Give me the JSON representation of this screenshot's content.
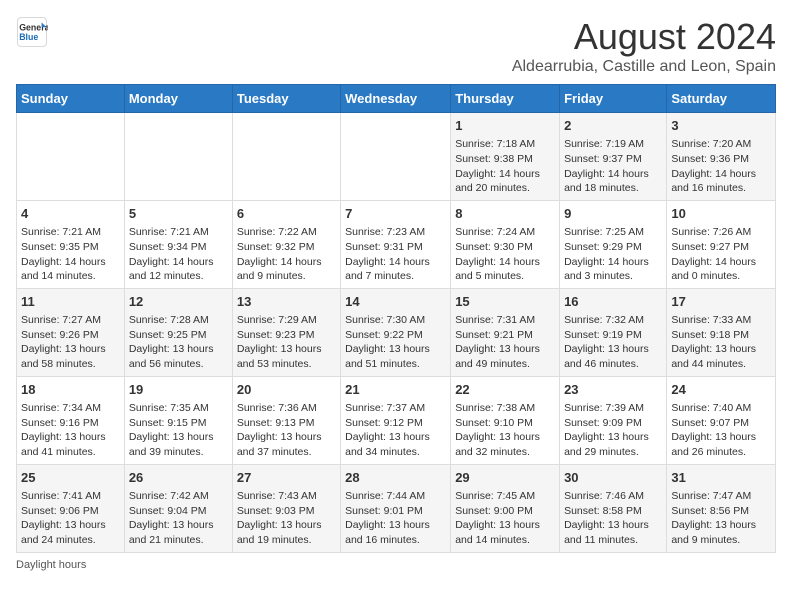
{
  "header": {
    "logo_general": "General",
    "logo_blue": "Blue",
    "title": "August 2024",
    "subtitle": "Aldearrubia, Castille and Leon, Spain"
  },
  "days_of_week": [
    "Sunday",
    "Monday",
    "Tuesday",
    "Wednesday",
    "Thursday",
    "Friday",
    "Saturday"
  ],
  "weeks": [
    [
      {
        "day": "",
        "info": ""
      },
      {
        "day": "",
        "info": ""
      },
      {
        "day": "",
        "info": ""
      },
      {
        "day": "",
        "info": ""
      },
      {
        "day": "1",
        "info": "Sunrise: 7:18 AM\nSunset: 9:38 PM\nDaylight: 14 hours and 20 minutes."
      },
      {
        "day": "2",
        "info": "Sunrise: 7:19 AM\nSunset: 9:37 PM\nDaylight: 14 hours and 18 minutes."
      },
      {
        "day": "3",
        "info": "Sunrise: 7:20 AM\nSunset: 9:36 PM\nDaylight: 14 hours and 16 minutes."
      }
    ],
    [
      {
        "day": "4",
        "info": "Sunrise: 7:21 AM\nSunset: 9:35 PM\nDaylight: 14 hours and 14 minutes."
      },
      {
        "day": "5",
        "info": "Sunrise: 7:21 AM\nSunset: 9:34 PM\nDaylight: 14 hours and 12 minutes."
      },
      {
        "day": "6",
        "info": "Sunrise: 7:22 AM\nSunset: 9:32 PM\nDaylight: 14 hours and 9 minutes."
      },
      {
        "day": "7",
        "info": "Sunrise: 7:23 AM\nSunset: 9:31 PM\nDaylight: 14 hours and 7 minutes."
      },
      {
        "day": "8",
        "info": "Sunrise: 7:24 AM\nSunset: 9:30 PM\nDaylight: 14 hours and 5 minutes."
      },
      {
        "day": "9",
        "info": "Sunrise: 7:25 AM\nSunset: 9:29 PM\nDaylight: 14 hours and 3 minutes."
      },
      {
        "day": "10",
        "info": "Sunrise: 7:26 AM\nSunset: 9:27 PM\nDaylight: 14 hours and 0 minutes."
      }
    ],
    [
      {
        "day": "11",
        "info": "Sunrise: 7:27 AM\nSunset: 9:26 PM\nDaylight: 13 hours and 58 minutes."
      },
      {
        "day": "12",
        "info": "Sunrise: 7:28 AM\nSunset: 9:25 PM\nDaylight: 13 hours and 56 minutes."
      },
      {
        "day": "13",
        "info": "Sunrise: 7:29 AM\nSunset: 9:23 PM\nDaylight: 13 hours and 53 minutes."
      },
      {
        "day": "14",
        "info": "Sunrise: 7:30 AM\nSunset: 9:22 PM\nDaylight: 13 hours and 51 minutes."
      },
      {
        "day": "15",
        "info": "Sunrise: 7:31 AM\nSunset: 9:21 PM\nDaylight: 13 hours and 49 minutes."
      },
      {
        "day": "16",
        "info": "Sunrise: 7:32 AM\nSunset: 9:19 PM\nDaylight: 13 hours and 46 minutes."
      },
      {
        "day": "17",
        "info": "Sunrise: 7:33 AM\nSunset: 9:18 PM\nDaylight: 13 hours and 44 minutes."
      }
    ],
    [
      {
        "day": "18",
        "info": "Sunrise: 7:34 AM\nSunset: 9:16 PM\nDaylight: 13 hours and 41 minutes."
      },
      {
        "day": "19",
        "info": "Sunrise: 7:35 AM\nSunset: 9:15 PM\nDaylight: 13 hours and 39 minutes."
      },
      {
        "day": "20",
        "info": "Sunrise: 7:36 AM\nSunset: 9:13 PM\nDaylight: 13 hours and 37 minutes."
      },
      {
        "day": "21",
        "info": "Sunrise: 7:37 AM\nSunset: 9:12 PM\nDaylight: 13 hours and 34 minutes."
      },
      {
        "day": "22",
        "info": "Sunrise: 7:38 AM\nSunset: 9:10 PM\nDaylight: 13 hours and 32 minutes."
      },
      {
        "day": "23",
        "info": "Sunrise: 7:39 AM\nSunset: 9:09 PM\nDaylight: 13 hours and 29 minutes."
      },
      {
        "day": "24",
        "info": "Sunrise: 7:40 AM\nSunset: 9:07 PM\nDaylight: 13 hours and 26 minutes."
      }
    ],
    [
      {
        "day": "25",
        "info": "Sunrise: 7:41 AM\nSunset: 9:06 PM\nDaylight: 13 hours and 24 minutes."
      },
      {
        "day": "26",
        "info": "Sunrise: 7:42 AM\nSunset: 9:04 PM\nDaylight: 13 hours and 21 minutes."
      },
      {
        "day": "27",
        "info": "Sunrise: 7:43 AM\nSunset: 9:03 PM\nDaylight: 13 hours and 19 minutes."
      },
      {
        "day": "28",
        "info": "Sunrise: 7:44 AM\nSunset: 9:01 PM\nDaylight: 13 hours and 16 minutes."
      },
      {
        "day": "29",
        "info": "Sunrise: 7:45 AM\nSunset: 9:00 PM\nDaylight: 13 hours and 14 minutes."
      },
      {
        "day": "30",
        "info": "Sunrise: 7:46 AM\nSunset: 8:58 PM\nDaylight: 13 hours and 11 minutes."
      },
      {
        "day": "31",
        "info": "Sunrise: 7:47 AM\nSunset: 8:56 PM\nDaylight: 13 hours and 9 minutes."
      }
    ]
  ],
  "footer": {
    "daylight_label": "Daylight hours"
  }
}
